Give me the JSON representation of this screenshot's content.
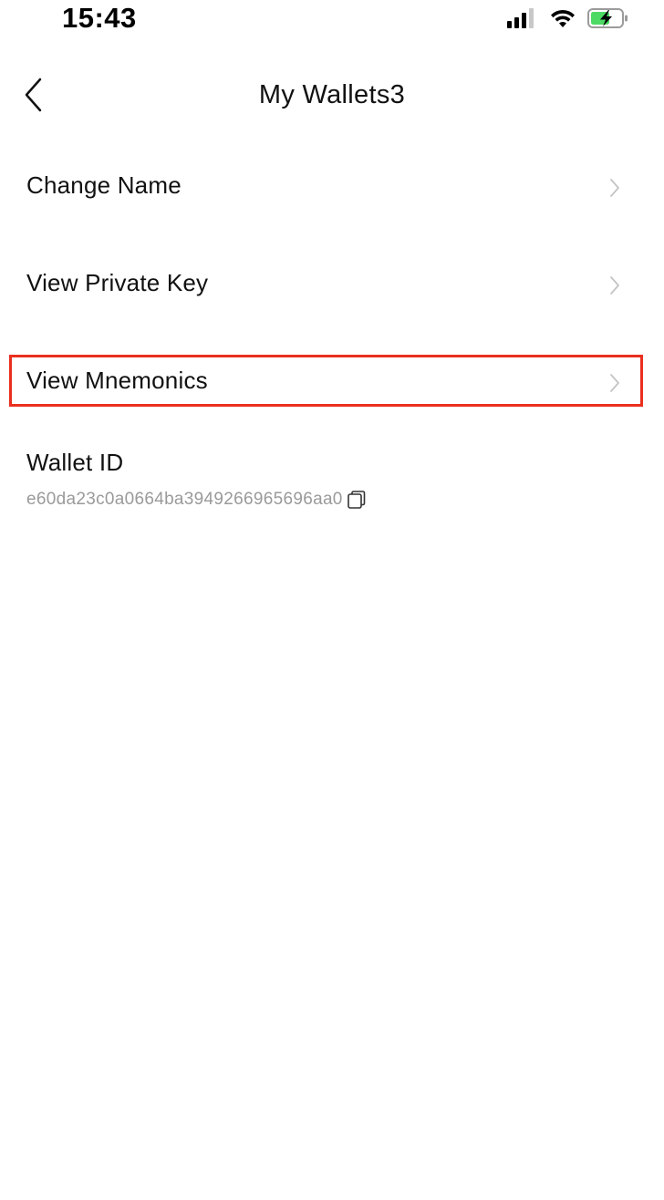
{
  "status_bar": {
    "time": "15:43",
    "icons": [
      "signal-icon",
      "wifi-icon",
      "battery-charging-icon"
    ]
  },
  "nav": {
    "back_icon": "chevron-left-icon",
    "title": "My Wallets3"
  },
  "menu": {
    "items": [
      {
        "label": "Change Name"
      },
      {
        "label": "View Private Key"
      },
      {
        "label": "View Mnemonics",
        "highlighted": true
      }
    ]
  },
  "wallet": {
    "id_label": "Wallet ID",
    "id_value": "e60da23c0a0664ba3949266965696aa0",
    "copy_icon": "copy-icon"
  },
  "colors": {
    "background": "#ffffff",
    "text": "#111111",
    "secondary_text": "#9a9a9a",
    "chevron": "#c4c4c4",
    "highlight_border": "#ea2f1f",
    "battery_charge": "#4cd964"
  }
}
